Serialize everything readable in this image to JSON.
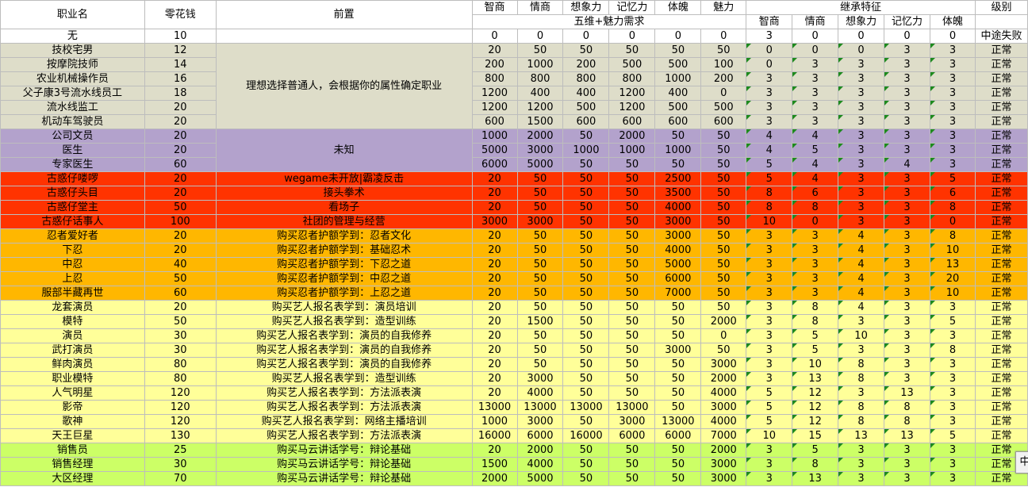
{
  "headers": {
    "job": "职业名",
    "money": "零花钱",
    "prereq": "前置",
    "req_cols": [
      "智商",
      "情商",
      "想象力",
      "记忆力",
      "体魄",
      "魅力"
    ],
    "req_group": "五维+魅力需求",
    "inherit_group": "继承特征",
    "inherit_cols": [
      "智商",
      "情商",
      "想象力",
      "记忆力",
      "体魄"
    ],
    "level": "级别"
  },
  "colors": {
    "gray": "#deddc9",
    "purple": "#b3a2cc",
    "red": "#ff3300",
    "orange": "#ffb700",
    "yellow": "#ffff99",
    "lime": "#ccff66",
    "white": "#ffffff"
  },
  "rows": [
    {
      "name": "无",
      "money": "10",
      "req": [
        "0",
        "0",
        "0",
        "0",
        "0",
        "0"
      ],
      "inh": [
        "3",
        "0",
        "0",
        "0",
        "0"
      ],
      "level": "中途失败",
      "band": "white"
    },
    {
      "name": "技校宅男",
      "money": "12",
      "req": [
        "20",
        "50",
        "50",
        "50",
        "50",
        "50"
      ],
      "inh": [
        "0",
        "0",
        "0",
        "3",
        "3"
      ],
      "level": "正常",
      "band": "gray"
    },
    {
      "name": "按摩院技师",
      "money": "14",
      "req": [
        "200",
        "1000",
        "200",
        "500",
        "500",
        "100"
      ],
      "inh": [
        "0",
        "3",
        "3",
        "3",
        "3"
      ],
      "level": "正常",
      "band": "gray"
    },
    {
      "name": "农业机械操作员",
      "money": "16",
      "req": [
        "800",
        "800",
        "800",
        "800",
        "1000",
        "200"
      ],
      "inh": [
        "3",
        "3",
        "3",
        "3",
        "3"
      ],
      "level": "正常",
      "band": "gray"
    },
    {
      "name": "父子康3号流水线员工",
      "money": "18",
      "req": [
        "1200",
        "400",
        "400",
        "1200",
        "400",
        "0"
      ],
      "inh": [
        "3",
        "3",
        "3",
        "3",
        "3"
      ],
      "level": "正常",
      "band": "gray"
    },
    {
      "name": "流水线监工",
      "money": "20",
      "req": [
        "1200",
        "1200",
        "500",
        "1200",
        "500",
        "500"
      ],
      "inh": [
        "3",
        "3",
        "3",
        "3",
        "3"
      ],
      "level": "正常",
      "band": "gray"
    },
    {
      "name": "机动车驾驶员",
      "money": "20",
      "req": [
        "600",
        "1500",
        "600",
        "600",
        "600",
        "600"
      ],
      "inh": [
        "3",
        "3",
        "3",
        "3",
        "3"
      ],
      "level": "正常",
      "band": "gray"
    },
    {
      "name": "公司文员",
      "money": "20",
      "req": [
        "1000",
        "2000",
        "50",
        "2000",
        "50",
        "50"
      ],
      "inh": [
        "4",
        "4",
        "3",
        "3",
        "3"
      ],
      "level": "正常",
      "band": "purple"
    },
    {
      "name": "医生",
      "money": "20",
      "req": [
        "5000",
        "3000",
        "1000",
        "1000",
        "1000",
        "50"
      ],
      "inh": [
        "4",
        "5",
        "3",
        "3",
        "3"
      ],
      "level": "正常",
      "band": "purple"
    },
    {
      "name": "专家医生",
      "money": "60",
      "req": [
        "6000",
        "5000",
        "50",
        "50",
        "50",
        "50"
      ],
      "inh": [
        "5",
        "4",
        "3",
        "4",
        "3"
      ],
      "level": "正常",
      "band": "purple"
    },
    {
      "name": "古惑仔喽啰",
      "money": "20",
      "req": [
        "20",
        "50",
        "50",
        "50",
        "2500",
        "50"
      ],
      "inh": [
        "5",
        "4",
        "3",
        "3",
        "5"
      ],
      "level": "正常",
      "band": "red"
    },
    {
      "name": "古惑仔头目",
      "money": "20",
      "req": [
        "20",
        "50",
        "50",
        "50",
        "3500",
        "50"
      ],
      "inh": [
        "8",
        "6",
        "3",
        "3",
        "6"
      ],
      "level": "正常",
      "band": "red"
    },
    {
      "name": "古惑仔堂主",
      "money": "50",
      "req": [
        "20",
        "50",
        "50",
        "50",
        "4000",
        "50"
      ],
      "inh": [
        "8",
        "8",
        "3",
        "3",
        "8"
      ],
      "level": "正常",
      "band": "red"
    },
    {
      "name": "古惑仔话事人",
      "money": "100",
      "req": [
        "3000",
        "3000",
        "50",
        "50",
        "3000",
        "50"
      ],
      "inh": [
        "10",
        "0",
        "3",
        "3",
        "0"
      ],
      "level": "正常",
      "band": "red"
    },
    {
      "name": "忍者爱好者",
      "money": "20",
      "req": [
        "20",
        "50",
        "50",
        "50",
        "3000",
        "50"
      ],
      "inh": [
        "3",
        "3",
        "4",
        "3",
        "8"
      ],
      "level": "正常",
      "band": "orange"
    },
    {
      "name": "下忍",
      "money": "20",
      "req": [
        "20",
        "50",
        "50",
        "50",
        "4000",
        "50"
      ],
      "inh": [
        "3",
        "3",
        "4",
        "3",
        "10"
      ],
      "level": "正常",
      "band": "orange"
    },
    {
      "name": "中忍",
      "money": "40",
      "req": [
        "20",
        "50",
        "50",
        "50",
        "5000",
        "50"
      ],
      "inh": [
        "3",
        "3",
        "4",
        "3",
        "13"
      ],
      "level": "正常",
      "band": "orange"
    },
    {
      "name": "上忍",
      "money": "50",
      "req": [
        "20",
        "50",
        "50",
        "50",
        "6000",
        "50"
      ],
      "inh": [
        "3",
        "3",
        "4",
        "3",
        "20"
      ],
      "level": "正常",
      "band": "orange"
    },
    {
      "name": "服部半藏再世",
      "money": "60",
      "req": [
        "20",
        "50",
        "50",
        "50",
        "7000",
        "50"
      ],
      "inh": [
        "3",
        "3",
        "4",
        "3",
        "10"
      ],
      "level": "正常",
      "band": "orange"
    },
    {
      "name": "龙套演员",
      "money": "20",
      "req": [
        "20",
        "50",
        "50",
        "50",
        "50",
        "50"
      ],
      "inh": [
        "3",
        "8",
        "4",
        "3",
        "3"
      ],
      "level": "正常",
      "band": "yellow"
    },
    {
      "name": "模特",
      "money": "50",
      "req": [
        "20",
        "1500",
        "50",
        "50",
        "50",
        "2000"
      ],
      "inh": [
        "3",
        "8",
        "3",
        "3",
        "5"
      ],
      "level": "正常",
      "band": "yellow"
    },
    {
      "name": "演员",
      "money": "30",
      "req": [
        "20",
        "50",
        "50",
        "50",
        "50",
        "0"
      ],
      "inh": [
        "3",
        "5",
        "10",
        "3",
        "3"
      ],
      "level": "正常",
      "band": "yellow"
    },
    {
      "name": "武打演员",
      "money": "30",
      "req": [
        "20",
        "50",
        "50",
        "50",
        "3000",
        "50"
      ],
      "inh": [
        "3",
        "5",
        "3",
        "3",
        "8"
      ],
      "level": "正常",
      "band": "yellow"
    },
    {
      "name": "鲜肉演员",
      "money": "80",
      "req": [
        "20",
        "50",
        "50",
        "50",
        "50",
        "3000"
      ],
      "inh": [
        "3",
        "10",
        "8",
        "3",
        "3"
      ],
      "level": "正常",
      "band": "yellow"
    },
    {
      "name": "职业模特",
      "money": "80",
      "req": [
        "20",
        "3000",
        "50",
        "50",
        "50",
        "2000"
      ],
      "inh": [
        "3",
        "13",
        "8",
        "3",
        "3"
      ],
      "level": "正常",
      "band": "yellow"
    },
    {
      "name": "人气明星",
      "money": "120",
      "req": [
        "20",
        "4000",
        "50",
        "50",
        "50",
        "4000"
      ],
      "inh": [
        "5",
        "12",
        "3",
        "13",
        "3"
      ],
      "level": "正常",
      "band": "yellow"
    },
    {
      "name": "影帝",
      "money": "120",
      "req": [
        "13000",
        "13000",
        "13000",
        "13000",
        "50",
        "3000"
      ],
      "inh": [
        "5",
        "12",
        "8",
        "8",
        "3"
      ],
      "level": "正常",
      "band": "yellow"
    },
    {
      "name": "歌神",
      "money": "120",
      "req": [
        "1000",
        "3000",
        "50",
        "3000",
        "13000",
        "4000"
      ],
      "inh": [
        "5",
        "12",
        "8",
        "8",
        "3"
      ],
      "level": "正常",
      "band": "yellow"
    },
    {
      "name": "天王巨星",
      "money": "130",
      "req": [
        "16000",
        "6000",
        "16000",
        "6000",
        "6000",
        "7000"
      ],
      "inh": [
        "10",
        "15",
        "13",
        "13",
        "5"
      ],
      "level": "正常",
      "band": "yellow"
    },
    {
      "name": "销售员",
      "money": "25",
      "req": [
        "20",
        "2000",
        "50",
        "50",
        "50",
        "2000"
      ],
      "inh": [
        "3",
        "5",
        "3",
        "3",
        "3"
      ],
      "level": "正常",
      "band": "lime"
    },
    {
      "name": "销售经理",
      "money": "30",
      "req": [
        "1500",
        "4000",
        "50",
        "50",
        "50",
        "3000"
      ],
      "inh": [
        "3",
        "8",
        "3",
        "3",
        "3"
      ],
      "level": "正常",
      "band": "lime"
    },
    {
      "name": "大区经理",
      "money": "70",
      "req": [
        "2000",
        "5000",
        "50",
        "50",
        "50",
        "3000"
      ],
      "inh": [
        "3",
        "13",
        "3",
        "3",
        "3"
      ],
      "level": "正常",
      "band": "lime"
    }
  ],
  "prereq_blocks": [
    {
      "start": 1,
      "span": 6,
      "text": "理想选择普通人，会根据你的属性确定职业"
    },
    {
      "start": 7,
      "span": 3,
      "text": "未知"
    },
    {
      "start": 10,
      "span": 1,
      "text": "wegame未开放|霸凌反击"
    },
    {
      "start": 11,
      "span": 1,
      "text": "接头拳术"
    },
    {
      "start": 12,
      "span": 1,
      "text": "看场子"
    },
    {
      "start": 13,
      "span": 1,
      "text": "社团的管理与经营"
    },
    {
      "start": 14,
      "span": 1,
      "text": "购买忍者护额学到：忍者文化"
    },
    {
      "start": 15,
      "span": 1,
      "text": "购买忍者护额学到：基础忍术"
    },
    {
      "start": 16,
      "span": 1,
      "text": "购买忍者护额学到：下忍之道"
    },
    {
      "start": 17,
      "span": 1,
      "text": "购买忍者护额学到：中忍之道"
    },
    {
      "start": 18,
      "span": 1,
      "text": "购买忍者护额学到：上忍之道"
    },
    {
      "start": 19,
      "span": 1,
      "text": "购买艺人报名表学到：演员培训"
    },
    {
      "start": 20,
      "span": 1,
      "text": "购买艺人报名表学到：造型训练"
    },
    {
      "start": 21,
      "span": 1,
      "text": "购买艺人报名表学到：演员的自我修养"
    },
    {
      "start": 22,
      "span": 1,
      "text": "购买艺人报名表学到：演员的自我修养"
    },
    {
      "start": 23,
      "span": 1,
      "text": "购买艺人报名表学到：演员的自我修养"
    },
    {
      "start": 24,
      "span": 1,
      "text": "购买艺人报名表学到：造型训练"
    },
    {
      "start": 25,
      "span": 1,
      "text": "购买艺人报名表学到：方法派表演"
    },
    {
      "start": 26,
      "span": 1,
      "text": "购买艺人报名表学到：方法派表演"
    },
    {
      "start": 27,
      "span": 1,
      "text": "购买艺人报名表学到：网络主播培训"
    },
    {
      "start": 28,
      "span": 1,
      "text": "购买艺人报名表学到：方法派表演"
    },
    {
      "start": 29,
      "span": 1,
      "text": "购买马云讲话学号：辩论基础"
    },
    {
      "start": 30,
      "span": 1,
      "text": "购买马云讲话学号：辩论基础"
    },
    {
      "start": 31,
      "span": 1,
      "text": "购买马云讲话学号：辩论基础"
    }
  ],
  "ime_indicator": "中"
}
